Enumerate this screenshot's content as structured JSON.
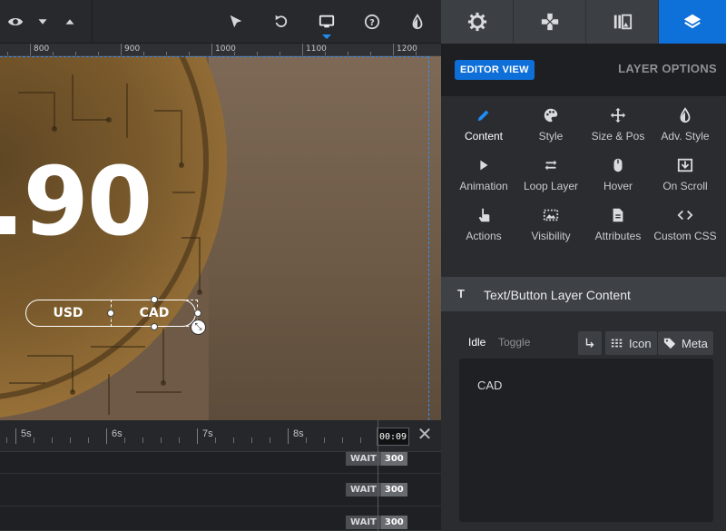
{
  "ruler": {
    "ticks": [
      "800",
      "900",
      "1000",
      "1100",
      "1200"
    ]
  },
  "canvas": {
    "price_text": ".90",
    "currency_toggle": {
      "left_label": "USD",
      "right_label": "CAD"
    }
  },
  "timeline": {
    "ticks": [
      "5s",
      "6s",
      "7s",
      "8s"
    ],
    "timecode": "00:09",
    "rows": [
      {
        "wait_label": "WAIT",
        "wait_value": "300"
      },
      {
        "wait_label": "WAIT",
        "wait_value": "300"
      },
      {
        "wait_label": "WAIT",
        "wait_value": "300"
      }
    ]
  },
  "toolbar": {
    "icons": [
      "eye-icon",
      "caret-down-icon",
      "caret-up-icon",
      "pointer-icon",
      "undo-icon",
      "desktop-icon",
      "help-icon",
      "contrast-icon"
    ]
  },
  "panel": {
    "tabs": [
      "gear-icon",
      "gamepad-icon",
      "library-icon",
      "layers-icon"
    ],
    "editor_view_label": "EDITOR VIEW",
    "layer_options_label": "LAYER OPTIONS",
    "options": [
      {
        "label": "Content",
        "icon": "pencil-icon"
      },
      {
        "label": "Style",
        "icon": "palette-icon"
      },
      {
        "label": "Size & Pos",
        "icon": "move-icon"
      },
      {
        "label": "Adv. Style",
        "icon": "drop-icon"
      },
      {
        "label": "Animation",
        "icon": "play-icon"
      },
      {
        "label": "Loop Layer",
        "icon": "loop-icon"
      },
      {
        "label": "Hover",
        "icon": "mouse-icon"
      },
      {
        "label": "On Scroll",
        "icon": "scroll-icon"
      },
      {
        "label": "Actions",
        "icon": "hand-pointer-icon"
      },
      {
        "label": "Visibility",
        "icon": "visibility-icon"
      },
      {
        "label": "Attributes",
        "icon": "document-icon"
      },
      {
        "label": "Custom CSS",
        "icon": "code-icon"
      }
    ],
    "section_title": "Text/Button Layer Content",
    "section_icon_text": "T",
    "state_idle": "Idle",
    "state_toggle": "Toggle",
    "icon_button_label": "Icon",
    "meta_button_label": "Meta",
    "content_text": "CAD"
  },
  "colors": {
    "accent": "#0e70d9",
    "panel_bg": "#2a2c30",
    "canvas_bg": "#6e5a46"
  }
}
